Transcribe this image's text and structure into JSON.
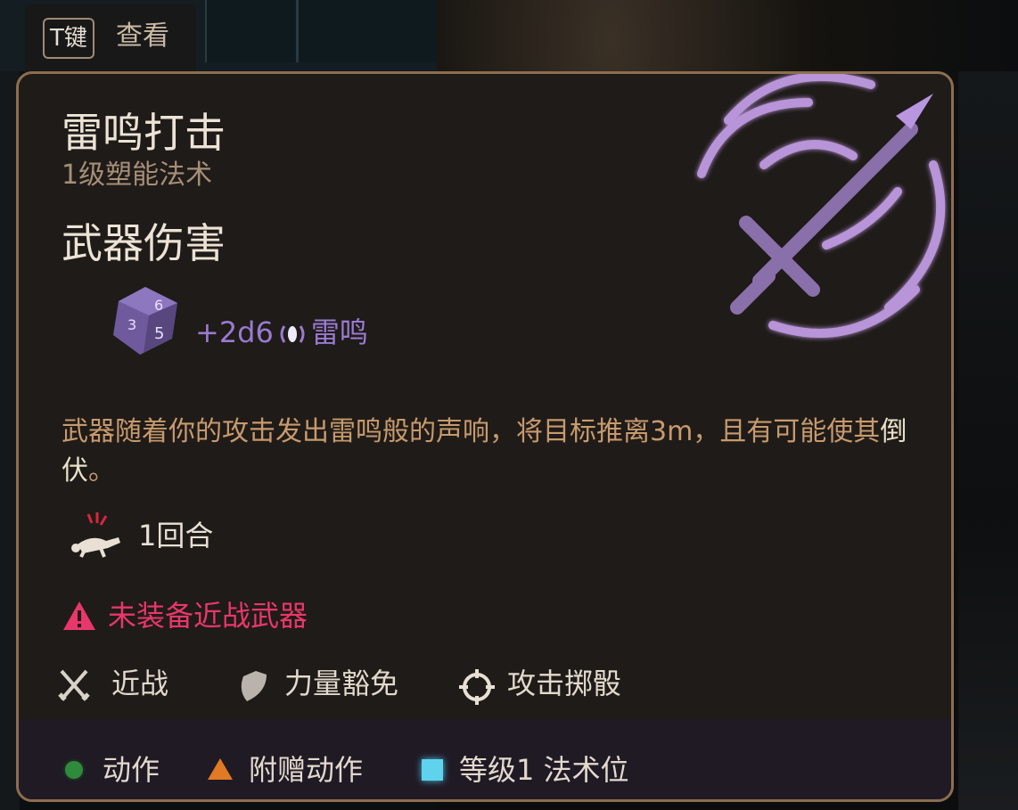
{
  "hint": {
    "key": "T键",
    "label": "查看"
  },
  "spell": {
    "name": "雷鸣打击",
    "subtitle": "1级塑能法术",
    "section_title": "武器伤害",
    "damage": {
      "dice": "+2d6",
      "type": "雷鸣"
    },
    "description_prefix": "武器随着你的攻击发出雷鸣般的声响，将目标推离3m，且有可能使其",
    "description_keyword": "倒伏",
    "description_suffix": "。",
    "duration": "1回合",
    "warning": "未装备近战武器",
    "properties": [
      {
        "label": "近战",
        "icon": "crossed-swords-icon"
      },
      {
        "label": "力量豁免",
        "icon": "shield-icon"
      },
      {
        "label": "攻击掷骰",
        "icon": "crosshair-icon"
      }
    ],
    "costs": [
      {
        "label": "动作",
        "icon": "action-circle-icon",
        "color": "#2f8a3c"
      },
      {
        "label": "附赠动作",
        "icon": "bonus-action-triangle-icon",
        "color": "#e07a24"
      },
      {
        "label": "等级1 法术位",
        "icon": "spell-slot-square-icon",
        "color": "#5fd3ee"
      }
    ]
  },
  "colors": {
    "accent_purple": "#9a7ad0",
    "warning_red": "#e8376a",
    "border_gold": "#8d6e50"
  }
}
